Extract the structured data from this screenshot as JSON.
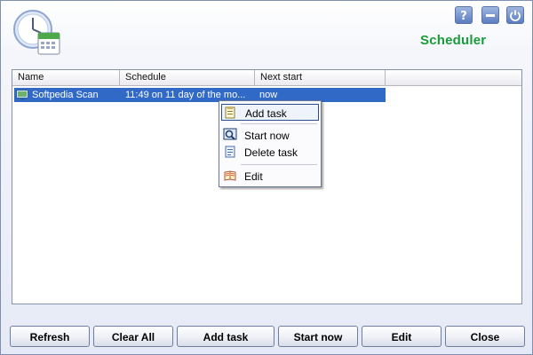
{
  "header": {
    "title": "Scheduler",
    "title_color": "#1a9b3a",
    "icons": [
      "clock-calendar-icon",
      "help-icon",
      "minimize-icon",
      "power-icon"
    ]
  },
  "list": {
    "columns": [
      "Name",
      "Schedule",
      "Next start"
    ],
    "rows": [
      {
        "name": "Softpedia Scan",
        "schedule": "11:49  on 11 day of the mo...",
        "next_start": "now",
        "icon": "scan-task-icon"
      }
    ],
    "selection_color": "#3169c6"
  },
  "context_menu": {
    "items": [
      {
        "label": "Add task",
        "icon": "add-task-icon"
      },
      {
        "label": "Start now",
        "icon": "start-now-icon"
      },
      {
        "label": "Delete task",
        "icon": "delete-task-icon"
      },
      {
        "label": "Edit",
        "icon": "edit-icon"
      }
    ]
  },
  "buttons": {
    "refresh": "Refresh",
    "clear_all": "Clear All",
    "add_task": "Add task",
    "start_now": "Start now",
    "edit": "Edit",
    "close": "Close"
  }
}
